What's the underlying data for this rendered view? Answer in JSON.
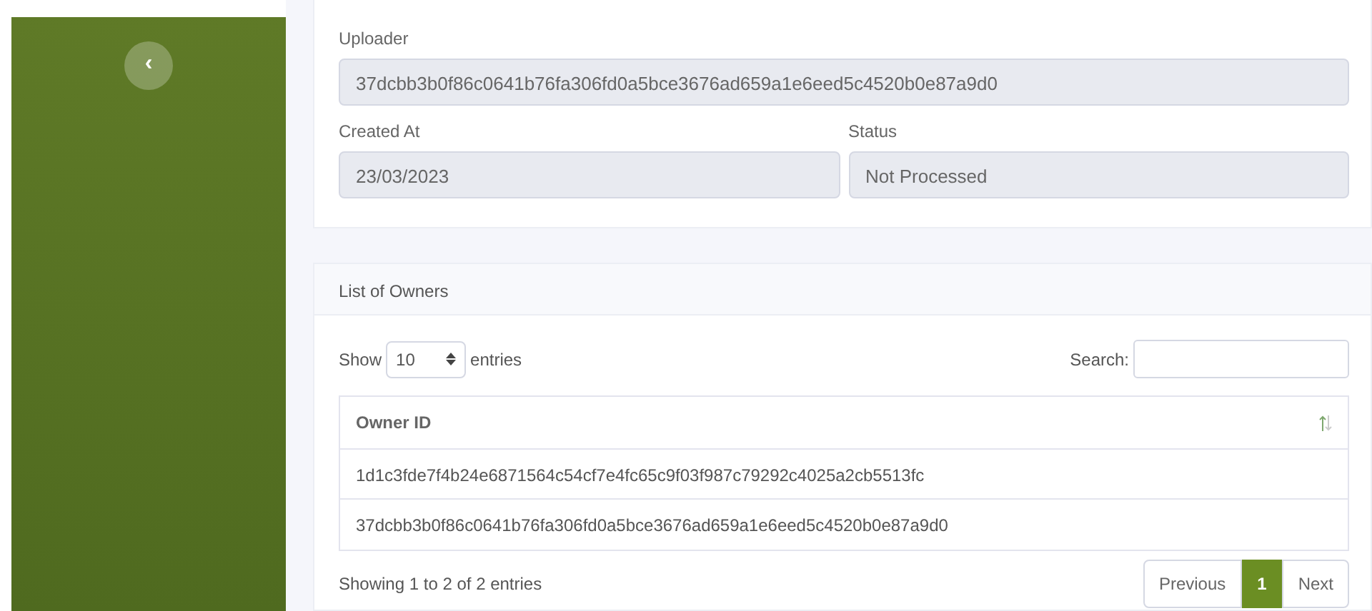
{
  "sidebar": {
    "collapse_button": "‹"
  },
  "details": {
    "uploader": {
      "label": "Uploader",
      "value": "37dcbb3b0f86c0641b76fa306fd0a5bce3676ad659a1e6eed5c4520b0e87a9d0"
    },
    "created_at": {
      "label": "Created At",
      "value": "23/03/2023"
    },
    "status": {
      "label": "Status",
      "value": "Not Processed"
    }
  },
  "owners": {
    "title": "List of Owners",
    "show_label": "Show",
    "page_size": "10",
    "entries_label": "entries",
    "search_label": "Search:",
    "columns": [
      "Owner ID"
    ],
    "rows": [
      [
        "1d1c3fde7f4b24e6871564c54cf7e4fc65c9f03f987c79292c4025a2cb5513fc"
      ],
      [
        "37dcbb3b0f86c0641b76fa306fd0a5bce3676ad659a1e6eed5c4520b0e87a9d0"
      ]
    ],
    "info": "Showing 1 to 2 of 2 entries",
    "pagination": [
      {
        "label": "Previous",
        "selected": false
      },
      {
        "label": "1",
        "selected": true
      },
      {
        "label": "Next",
        "selected": false
      }
    ]
  }
}
